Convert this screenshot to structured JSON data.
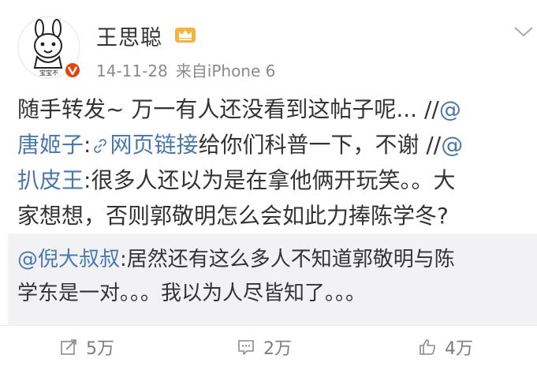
{
  "user": {
    "name": "王思聪",
    "avatar_caption": "宝宝不",
    "badge_icon": "crown-icon",
    "verified_icon": "verified-v-icon",
    "verified_color": "#e6420d"
  },
  "meta": {
    "date": "14-11-28",
    "source": "来自iPhone 6"
  },
  "post": {
    "line1": "随手转发~ 万一有人还没看到这帖子呢... //",
    "line1_link": "@",
    "line2_link": "唐姬子",
    "line2_sep": ":",
    "line2_weblink": "网页链接",
    "line2_rest": "给你们科普一下，不谢 //",
    "line2_at": "@",
    "line3_link": "扒皮王",
    "line3_rest": ":很多人还以为是在拿他俩开玩笑。。大",
    "line4": "家想想，否则郭敬明怎么会如此力捧陈学冬?"
  },
  "retweet": {
    "author": "@倪大叔叔",
    "line1_rest": ":居然还有这么多人不知道郭敬明与陈",
    "line2": "学东是一对。。。我以为人尽皆知了。。。"
  },
  "actions": {
    "repost_count": "5万",
    "comment_count": "2万",
    "like_count": "4万"
  },
  "colors": {
    "link": "#4b78ac",
    "retweet_bg": "#f2f2f5",
    "muted": "#8a8a8a"
  }
}
